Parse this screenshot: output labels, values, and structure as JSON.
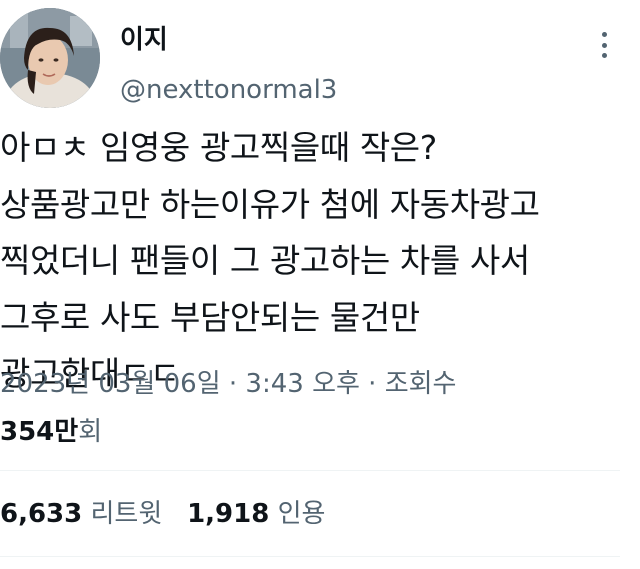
{
  "tweet": {
    "author_name": "이지",
    "author_handle": "@nexttonormal3",
    "text": "아ㅁㅊ 임영웅 광고찍을때 작은?\n상품광고만 하는이유가 첨에 자동차광고\n찍었더니 팬들이 그 광고하는 차를 사서\n그후로 사도 부담안되는 물건만\n광고한대ㄷㄷ",
    "timestamp": "2023년 03월 06일 · 3:43 오후 · 조회수",
    "views_count": "354만",
    "views_suffix": "회",
    "retweets_count": "6,633",
    "retweets_label": "리트윗",
    "quotes_count": "1,918",
    "quotes_label": "인용"
  },
  "icons": {
    "avatar": "avatar",
    "more": "more-vertical-icon"
  },
  "colors": {
    "text_primary": "#0f1419",
    "text_secondary": "#536471",
    "divider": "#eff3f4"
  }
}
